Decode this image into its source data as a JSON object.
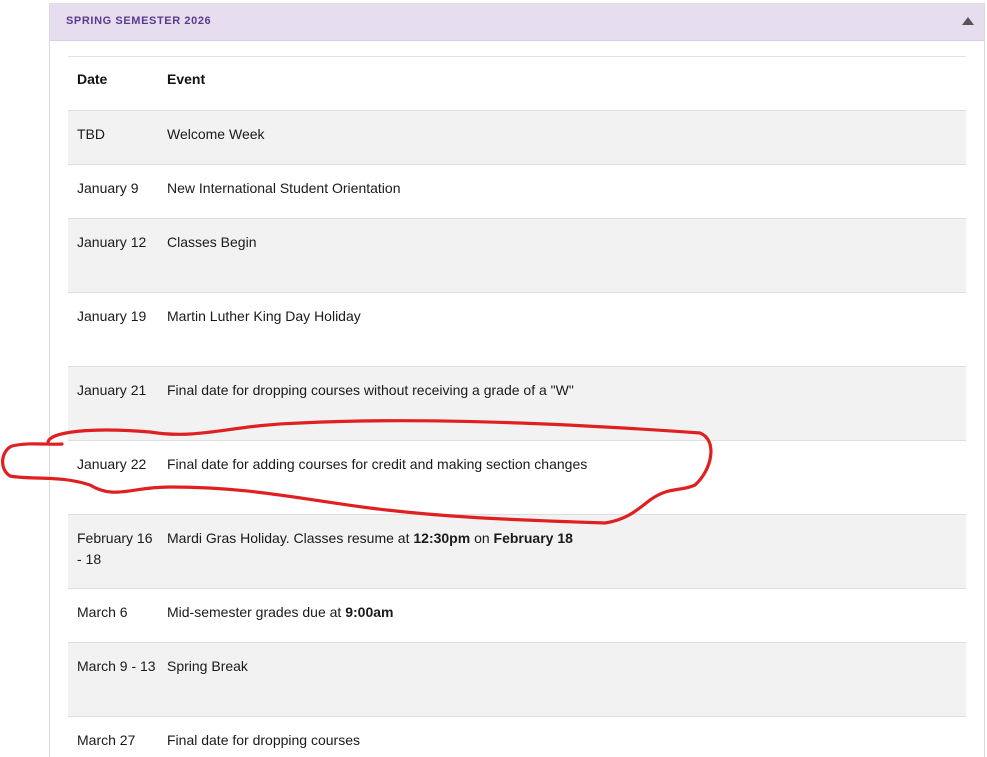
{
  "section": {
    "title": "SPRING SEMESTER 2026",
    "toggle_icon": "caret-up-icon"
  },
  "table": {
    "headers": {
      "date": "Date",
      "event": "Event"
    },
    "rows": [
      {
        "date": "TBD",
        "event": "Welcome Week"
      },
      {
        "date": "January 9",
        "event": "New International Student Orientation"
      },
      {
        "date": "January 12",
        "event": "Classes Begin"
      },
      {
        "date": "January 19",
        "event": "Martin Luther King Day Holiday"
      },
      {
        "date": "January 21",
        "event": "Final date for dropping courses without receiving a grade of a \"W\""
      },
      {
        "date": "January 22",
        "event": "Final date for adding courses for credit and making section changes"
      },
      {
        "date": "February 16 - 18",
        "event_parts": [
          "Mardi Gras Holiday. Classes resume at ",
          "12:30pm",
          " on ",
          "February 18"
        ]
      },
      {
        "date": "March 6",
        "event_parts": [
          "Mid-semester grades due at ",
          "9:00am"
        ]
      },
      {
        "date": "March 9 - 13",
        "event": "Spring Break"
      },
      {
        "date": "March 27",
        "event": "Final date for dropping courses"
      }
    ]
  },
  "annotation": {
    "type": "hand-drawn circle",
    "color": "#e02020",
    "target_row": "January 22"
  }
}
